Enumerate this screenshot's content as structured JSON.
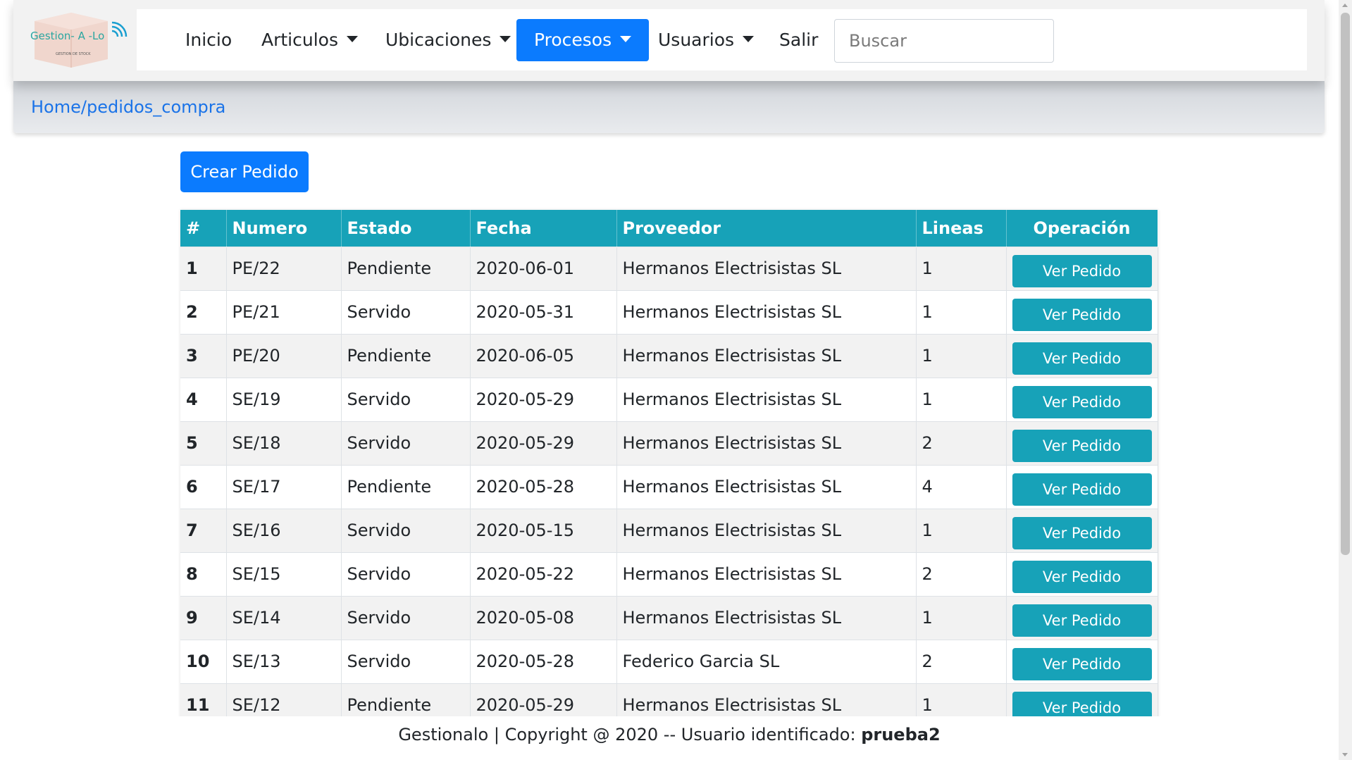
{
  "logo": {
    "text": "Gestion- A -Lo",
    "tagline": "GESTION DE STOCK"
  },
  "nav": {
    "items": [
      {
        "label": "Inicio",
        "dropdown": false
      },
      {
        "label": "Articulos",
        "dropdown": true
      },
      {
        "label": "Ubicaciones",
        "dropdown": true
      },
      {
        "label": "Procesos",
        "dropdown": true,
        "active": true
      },
      {
        "label": "Usuarios",
        "dropdown": true
      },
      {
        "label": "Salir",
        "dropdown": false
      }
    ],
    "search_placeholder": "Buscar"
  },
  "breadcrumb": "Home/pedidos_compra",
  "create_button": "Crear Pedido",
  "table": {
    "headers": [
      "#",
      "Numero",
      "Estado",
      "Fecha",
      "Proveedor",
      "Lineas",
      "Operación"
    ],
    "action_label": "Ver Pedido",
    "rows": [
      {
        "idx": "1",
        "numero": "PE/22",
        "estado": "Pendiente",
        "fecha": "2020-06-01",
        "proveedor": "Hermanos Electrisistas SL",
        "lineas": "1"
      },
      {
        "idx": "2",
        "numero": "PE/21",
        "estado": "Servido",
        "fecha": "2020-05-31",
        "proveedor": "Hermanos Electrisistas SL",
        "lineas": "1"
      },
      {
        "idx": "3",
        "numero": "PE/20",
        "estado": "Pendiente",
        "fecha": "2020-06-05",
        "proveedor": "Hermanos Electrisistas SL",
        "lineas": "1"
      },
      {
        "idx": "4",
        "numero": "SE/19",
        "estado": "Servido",
        "fecha": "2020-05-29",
        "proveedor": "Hermanos Electrisistas SL",
        "lineas": "1"
      },
      {
        "idx": "5",
        "numero": "SE/18",
        "estado": "Servido",
        "fecha": "2020-05-29",
        "proveedor": "Hermanos Electrisistas SL",
        "lineas": "2"
      },
      {
        "idx": "6",
        "numero": "SE/17",
        "estado": "Pendiente",
        "fecha": "2020-05-28",
        "proveedor": "Hermanos Electrisistas SL",
        "lineas": "4"
      },
      {
        "idx": "7",
        "numero": "SE/16",
        "estado": "Servido",
        "fecha": "2020-05-15",
        "proveedor": "Hermanos Electrisistas SL",
        "lineas": "1"
      },
      {
        "idx": "8",
        "numero": "SE/15",
        "estado": "Servido",
        "fecha": "2020-05-22",
        "proveedor": "Hermanos Electrisistas SL",
        "lineas": "2"
      },
      {
        "idx": "9",
        "numero": "SE/14",
        "estado": "Servido",
        "fecha": "2020-05-08",
        "proveedor": "Hermanos Electrisistas SL",
        "lineas": "1"
      },
      {
        "idx": "10",
        "numero": "SE/13",
        "estado": "Servido",
        "fecha": "2020-05-28",
        "proveedor": "Federico Garcia SL",
        "lineas": "2"
      },
      {
        "idx": "11",
        "numero": "SE/12",
        "estado": "Pendiente",
        "fecha": "2020-05-29",
        "proveedor": "Hermanos Electrisistas SL",
        "lineas": "1"
      }
    ]
  },
  "footer": {
    "text": "Gestionalo | Copyright @ 2020 -- Usuario identificado: ",
    "user": "prueba2"
  },
  "colors": {
    "primary": "#0b7bfe",
    "info": "#17a2b8",
    "link": "#1a73e8"
  }
}
